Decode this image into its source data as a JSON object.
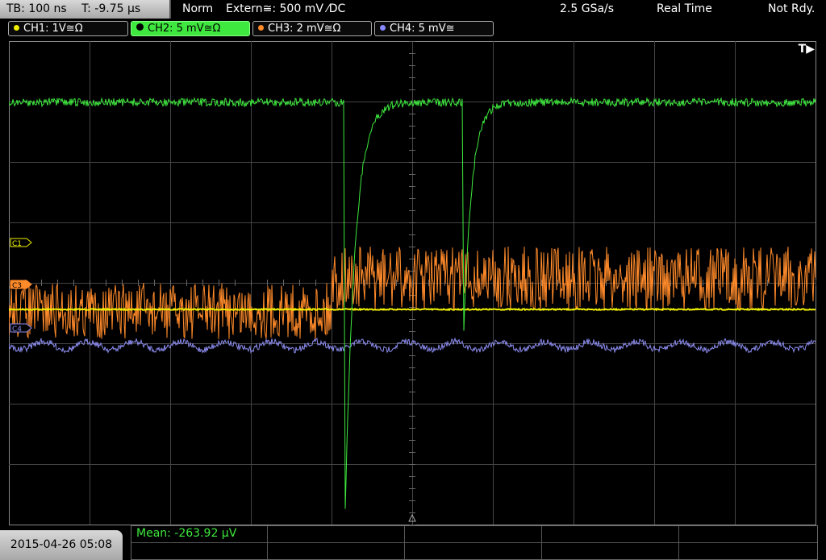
{
  "topbar": {
    "timebase": "TB: 100 ns",
    "trigger_time": "T: -9.75 µs",
    "mode": "Norm",
    "trigger": "Extern≅: 500 mV ⁄DC",
    "sample_rate": "2.5 GSa/s",
    "acq_mode": "Real Time",
    "status": "Not Rdy."
  },
  "channels": [
    {
      "label": "CH1: 1V≅Ω",
      "color": "#f0f000"
    },
    {
      "label": "CH2: 5 mV≅Ω",
      "color": "#3ee83e"
    },
    {
      "label": "CH3: 2 mV≅Ω",
      "color": "#ff8a2a"
    },
    {
      "label": "CH4: 5 mV≅",
      "color": "#8888ff"
    }
  ],
  "markers": {
    "c1": "C1",
    "c3": "C3",
    "c4": "C4",
    "trigger_indicator": "T▶"
  },
  "footer": {
    "datetime": "2015-04-26 05:08",
    "mean": "Mean: -263.92 µV"
  }
}
